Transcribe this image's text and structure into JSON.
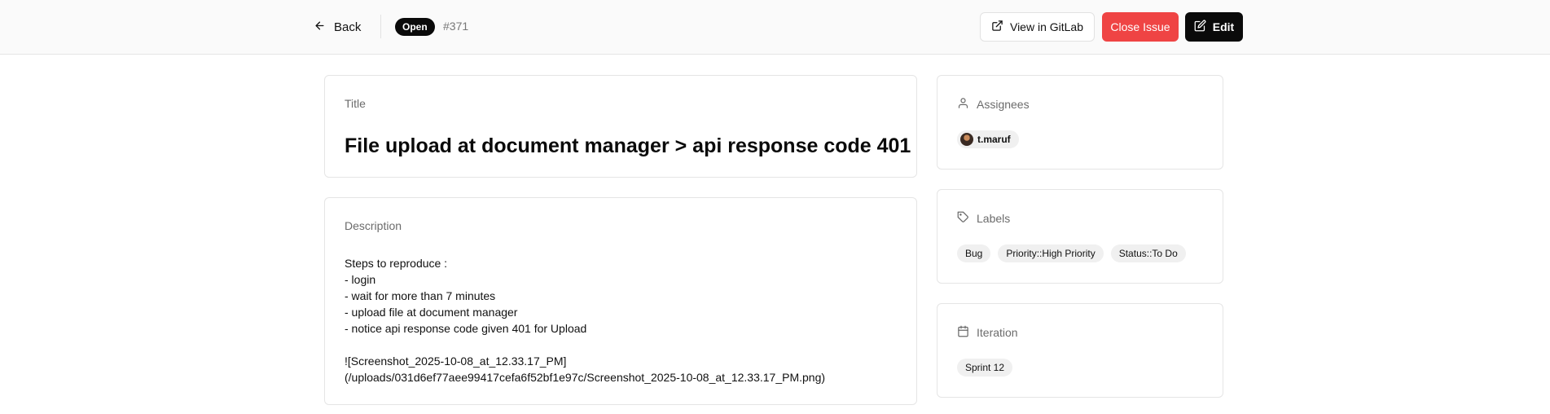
{
  "header": {
    "back_label": "Back",
    "status": "Open",
    "issue_number": "#371",
    "view_gitlab_label": "View in GitLab",
    "close_label": "Close Issue",
    "edit_label": "Edit"
  },
  "issue": {
    "title_label": "Title",
    "title": "File upload at document manager > api response code 401",
    "description_label": "Description",
    "description_lines": [
      "Steps to reproduce :",
      "- login",
      "- wait for more than 7 minutes",
      "- upload file at document manager",
      "- notice api response code given 401 for Upload",
      "",
      "![Screenshot_2025-10-08_at_12.33.17_PM](/uploads/031d6ef77aee99417cefa6f52bf1e97c/Screenshot_2025-10-08_at_12.33.17_PM.png)"
    ]
  },
  "sidebar": {
    "assignees_label": "Assignees",
    "assignees": [
      "t.maruf"
    ],
    "labels_label": "Labels",
    "labels": [
      "Bug",
      "Priority::High Priority",
      "Status::To Do"
    ],
    "iteration_label": "Iteration",
    "iteration": "Sprint 12"
  },
  "icons": {
    "back": "arrow-left-icon",
    "external": "external-link-icon",
    "edit": "edit-icon",
    "user": "user-icon",
    "tag": "tag-icon",
    "calendar": "calendar-icon"
  },
  "colors": {
    "danger": "#ef4444",
    "primary": "#0a0a0a"
  }
}
